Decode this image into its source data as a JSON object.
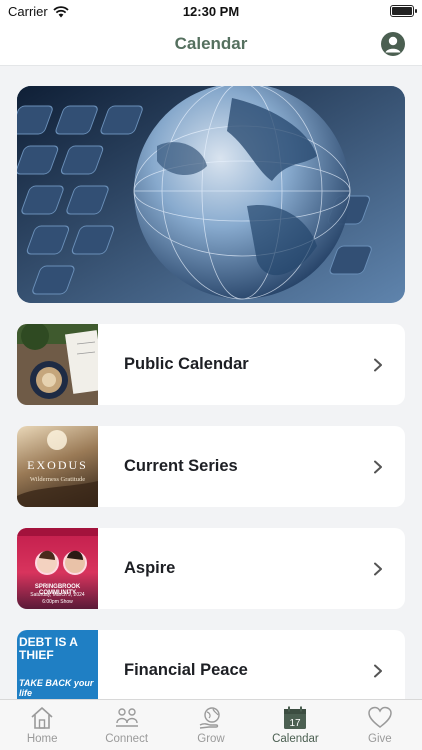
{
  "status_bar": {
    "carrier": "Carrier",
    "time": "12:30 PM"
  },
  "header": {
    "title": "Calendar",
    "profile_icon": "person-circle-icon"
  },
  "hero": {
    "image": "glass-globe-on-keyboard"
  },
  "cards": [
    {
      "label": "Public Calendar",
      "thumb": "coffee-notebook-photo"
    },
    {
      "label": "Current Series",
      "thumb": "exodus-series-art",
      "thumb_text": "EXODUS",
      "thumb_subtext": "Wilderness Gratitude"
    },
    {
      "label": "Aspire",
      "thumb": "aspire-event-poster",
      "thumb_text": "SPRINGBROOK COMMUNITY",
      "thumb_subtext": "Saturday, March 9, 2024",
      "thumb_subtext2": "6:00pm Show"
    },
    {
      "label": "Financial Peace",
      "thumb": "debt-is-a-thief-poster",
      "thumb_text": "DEBT IS A THIEF",
      "thumb_subtext": "TAKE BACK your life"
    }
  ],
  "tabs": [
    {
      "label": "Home",
      "icon": "house-icon"
    },
    {
      "label": "Connect",
      "icon": "people-icon"
    },
    {
      "label": "Grow",
      "icon": "globe-hand-icon"
    },
    {
      "label": "Calendar",
      "icon": "calendar-icon",
      "badge": "17",
      "active": true
    },
    {
      "label": "Give",
      "icon": "heart-icon"
    }
  ],
  "colors": {
    "accent": "#4b5f51",
    "title": "#55705f",
    "inactive": "#9a9a9a"
  }
}
